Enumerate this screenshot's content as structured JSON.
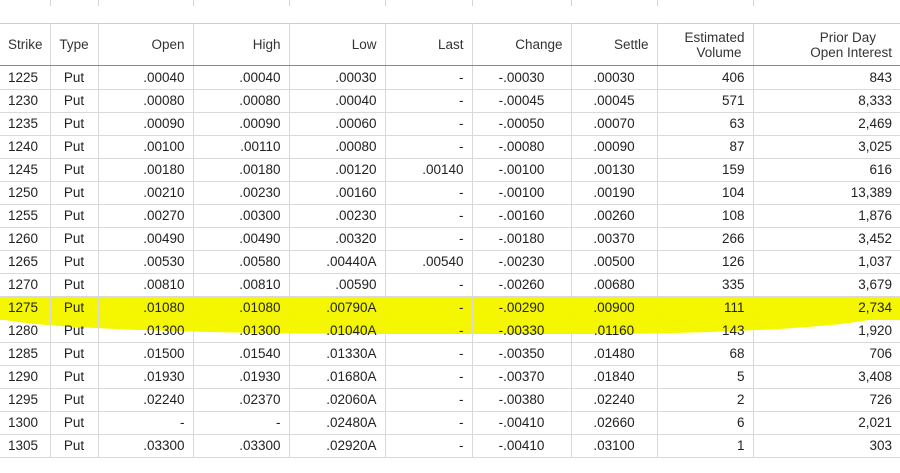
{
  "columns": {
    "strike": "Strike",
    "type": "Type",
    "open": "Open",
    "high": "High",
    "low": "Low",
    "last": "Last",
    "change": "Change",
    "settle": "Settle",
    "est_volume_line1": "Estimated",
    "est_volume_line2": "Volume",
    "prior_oi_line1": "Prior Day",
    "prior_oi_line2": "Open Interest"
  },
  "highlight_color": "#f5f700",
  "highlighted_row_index": 10,
  "rows": [
    {
      "strike": "1225",
      "type": "Put",
      "open": ".00040",
      "high": ".00040",
      "low": ".00030",
      "last": "-",
      "change": "-.00030",
      "settle": ".00030",
      "volume": "406",
      "oi": "843"
    },
    {
      "strike": "1230",
      "type": "Put",
      "open": ".00080",
      "high": ".00080",
      "low": ".00040",
      "last": "-",
      "change": "-.00045",
      "settle": ".00045",
      "volume": "571",
      "oi": "8,333"
    },
    {
      "strike": "1235",
      "type": "Put",
      "open": ".00090",
      "high": ".00090",
      "low": ".00060",
      "last": "-",
      "change": "-.00050",
      "settle": ".00070",
      "volume": "63",
      "oi": "2,469"
    },
    {
      "strike": "1240",
      "type": "Put",
      "open": ".00100",
      "high": ".00110",
      "low": ".00080",
      "last": "-",
      "change": "-.00080",
      "settle": ".00090",
      "volume": "87",
      "oi": "3,025"
    },
    {
      "strike": "1245",
      "type": "Put",
      "open": ".00180",
      "high": ".00180",
      "low": ".00120",
      "last": ".00140",
      "change": "-.00100",
      "settle": ".00130",
      "volume": "159",
      "oi": "616"
    },
    {
      "strike": "1250",
      "type": "Put",
      "open": ".00210",
      "high": ".00230",
      "low": ".00160",
      "last": "-",
      "change": "-.00100",
      "settle": ".00190",
      "volume": "104",
      "oi": "13,389"
    },
    {
      "strike": "1255",
      "type": "Put",
      "open": ".00270",
      "high": ".00300",
      "low": ".00230",
      "last": "-",
      "change": "-.00160",
      "settle": ".00260",
      "volume": "108",
      "oi": "1,876"
    },
    {
      "strike": "1260",
      "type": "Put",
      "open": ".00490",
      "high": ".00490",
      "low": ".00320",
      "last": "-",
      "change": "-.00180",
      "settle": ".00370",
      "volume": "266",
      "oi": "3,452"
    },
    {
      "strike": "1265",
      "type": "Put",
      "open": ".00530",
      "high": ".00580",
      "low": ".00440A",
      "last": ".00540",
      "change": "-.00230",
      "settle": ".00500",
      "volume": "126",
      "oi": "1,037"
    },
    {
      "strike": "1270",
      "type": "Put",
      "open": ".00810",
      "high": ".00810",
      "low": ".00590",
      "last": "-",
      "change": "-.00260",
      "settle": ".00680",
      "volume": "335",
      "oi": "3,679"
    },
    {
      "strike": "1275",
      "type": "Put",
      "open": ".01080",
      "high": ".01080",
      "low": ".00790A",
      "last": "-",
      "change": "-.00290",
      "settle": ".00900",
      "volume": "111",
      "oi": "2,734"
    },
    {
      "strike": "1280",
      "type": "Put",
      "open": ".01300",
      "high": ".01300",
      "low": ".01040A",
      "last": "-",
      "change": "-.00330",
      "settle": ".01160",
      "volume": "143",
      "oi": "1,920"
    },
    {
      "strike": "1285",
      "type": "Put",
      "open": ".01500",
      "high": ".01540",
      "low": ".01330A",
      "last": "-",
      "change": "-.00350",
      "settle": ".01480",
      "volume": "68",
      "oi": "706"
    },
    {
      "strike": "1290",
      "type": "Put",
      "open": ".01930",
      "high": ".01930",
      "low": ".01680A",
      "last": "-",
      "change": "-.00370",
      "settle": ".01840",
      "volume": "5",
      "oi": "3,408"
    },
    {
      "strike": "1295",
      "type": "Put",
      "open": ".02240",
      "high": ".02370",
      "low": ".02060A",
      "last": "-",
      "change": "-.00380",
      "settle": ".02240",
      "volume": "2",
      "oi": "726"
    },
    {
      "strike": "1300",
      "type": "Put",
      "open": "-",
      "high": "-",
      "low": ".02480A",
      "last": "-",
      "change": "-.00410",
      "settle": ".02660",
      "volume": "6",
      "oi": "2,021"
    },
    {
      "strike": "1305",
      "type": "Put",
      "open": ".03300",
      "high": ".03300",
      "low": ".02920A",
      "last": "-",
      "change": "-.00410",
      "settle": ".03100",
      "volume": "1",
      "oi": "303"
    }
  ]
}
